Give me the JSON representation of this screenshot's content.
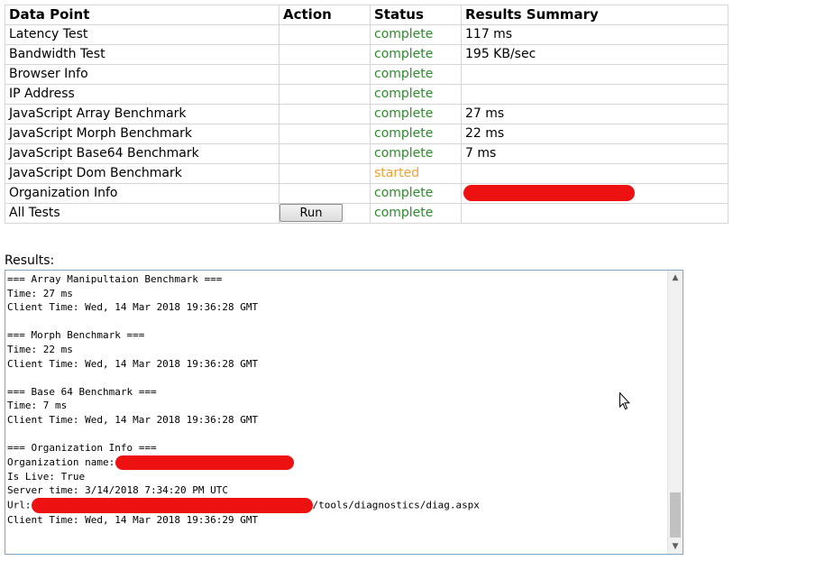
{
  "table": {
    "headers": [
      "Data Point",
      "Action",
      "Status",
      "Results Summary"
    ],
    "rows": [
      {
        "data_point": "Latency Test",
        "status": "complete",
        "summary": "117 ms"
      },
      {
        "data_point": "Bandwidth Test",
        "status": "complete",
        "summary": "195 KB/sec"
      },
      {
        "data_point": "Browser Info",
        "status": "complete",
        "summary": ""
      },
      {
        "data_point": "IP Address",
        "status": "complete",
        "summary": ""
      },
      {
        "data_point": "JavaScript Array Benchmark",
        "status": "complete",
        "summary": "27 ms"
      },
      {
        "data_point": "JavaScript Morph Benchmark",
        "status": "complete",
        "summary": "22 ms"
      },
      {
        "data_point": "JavaScript Base64 Benchmark",
        "status": "complete",
        "summary": "7 ms"
      },
      {
        "data_point": "JavaScript Dom Benchmark",
        "status": "started",
        "summary": ""
      },
      {
        "data_point": "Organization Info",
        "status": "complete",
        "summary": ""
      },
      {
        "data_point": "All Tests",
        "status": "complete",
        "summary": "",
        "action_label": "Run"
      }
    ]
  },
  "results": {
    "label": "Results:",
    "lines": [
      "=== Array Manipultaion Benchmark ===",
      "Time: 27 ms",
      "Client Time: Wed, 14 Mar 2018 19:36:28 GMT",
      "",
      "=== Morph Benchmark ===",
      "Time: 22 ms",
      "Client Time: Wed, 14 Mar 2018 19:36:28 GMT",
      "",
      "=== Base 64 Benchmark ===",
      "Time: 7 ms",
      "Client Time: Wed, 14 Mar 2018 19:36:28 GMT",
      "",
      "=== Organization Info ===",
      "Organization name: ",
      "Is Live: True",
      "Server time: 3/14/2018 7:34:20 PM UTC",
      "Url:",
      "Client Time: Wed, 14 Mar 2018 19:36:29 GMT"
    ],
    "url_suffix": "/tools/diagnostics/diag.aspx"
  },
  "colors": {
    "complete": "#2e8b2e",
    "started": "#f0a030",
    "redaction": "#ee1111",
    "results_border": "#7aa7c7"
  },
  "icons": {
    "cursor": "mouse-pointer-icon",
    "scroll_up": "chevron-up-icon",
    "scroll_down": "chevron-down-icon"
  }
}
